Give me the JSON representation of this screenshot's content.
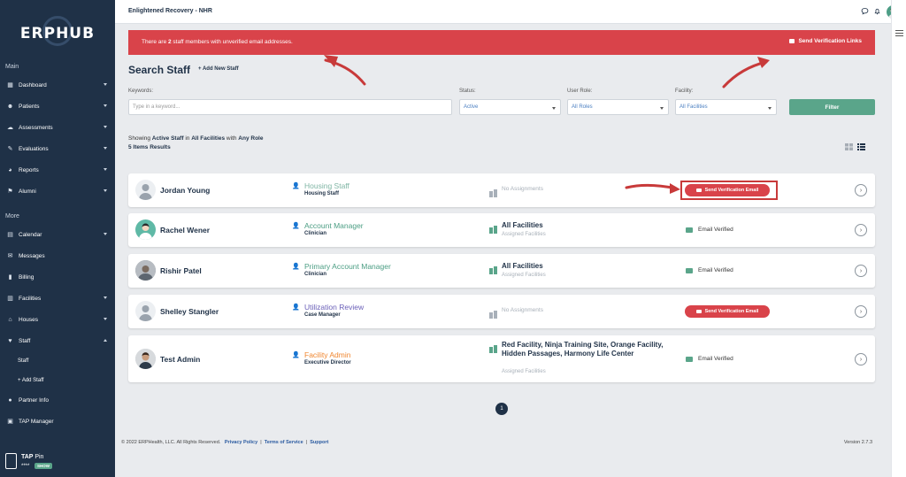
{
  "sidebar": {
    "logo": "ERPHUB",
    "main_label": "Main",
    "more_label": "More",
    "items": [
      {
        "label": "Dashboard",
        "icon": "dashboard-icon"
      },
      {
        "label": "Patients",
        "icon": "patients-icon"
      },
      {
        "label": "Assessments",
        "icon": "assessments-icon"
      },
      {
        "label": "Evaluations",
        "icon": "evaluations-icon"
      },
      {
        "label": "Reports",
        "icon": "reports-icon"
      },
      {
        "label": "Alumni",
        "icon": "alumni-icon"
      },
      {
        "label": "Calendar",
        "icon": "calendar-icon"
      },
      {
        "label": "Messages",
        "icon": "messages-icon"
      },
      {
        "label": "Billing",
        "icon": "billing-icon"
      },
      {
        "label": "Facilities",
        "icon": "facilities-icon"
      },
      {
        "label": "Houses",
        "icon": "houses-icon"
      },
      {
        "label": "Staff",
        "icon": "staff-icon"
      },
      {
        "label": "Partner Info",
        "icon": "partner-icon"
      },
      {
        "label": "TAP Manager",
        "icon": "tap-manager-icon"
      }
    ],
    "sub_items": [
      "Staff",
      "+ Add Staff"
    ],
    "tap": {
      "title_bold": "TAP",
      "title_rest": "Pin",
      "mask": "****",
      "show": "SHOW"
    }
  },
  "topbar": {
    "title": "Enlightened Recovery - NHR"
  },
  "alert": {
    "text_before": "There are ",
    "count": "2",
    "text_after": " staff members with unverified email addresses.",
    "button": "Send Verification Links"
  },
  "page": {
    "title": "Search Staff",
    "add_new": "+ Add New Staff"
  },
  "filters": {
    "keywords_label": "Keywords:",
    "keywords_placeholder": "Type in a keyword...",
    "status_label": "Status:",
    "status_value": "Active",
    "role_label": "User Role:",
    "role_value": "All Roles",
    "facility_label": "Facility:",
    "facility_value": "All Facilities",
    "filter_button": "Filter"
  },
  "summary": {
    "showing_pre": "Showing ",
    "status": "Active Staff",
    "in": " in ",
    "facility": "All Facilities",
    "with": " with ",
    "role": "Any Role",
    "results": "5 Items Results"
  },
  "staff": [
    {
      "name": "Jordan Young",
      "role": "Housing Staff",
      "role_color": "#7fb5a4",
      "title": "Housing Staff",
      "facilities": "No Assignments",
      "facility_sub": "",
      "verified": false,
      "action": "Send Verification Email"
    },
    {
      "name": "Rachel Wener",
      "role": "Account Manager",
      "role_color": "#4c9e84",
      "title": "Clinician",
      "facilities": "All Facilities",
      "facility_sub": "Assigned Facilities",
      "verified": true,
      "action": "Email Verified"
    },
    {
      "name": "Rishir Patel",
      "role": "Primary Account Manager",
      "role_color": "#4c9e84",
      "title": "Clinician",
      "facilities": "All Facilities",
      "facility_sub": "Assigned Facilities",
      "verified": true,
      "action": "Email Verified"
    },
    {
      "name": "Shelley Stangler",
      "role": "Utilization Review",
      "role_color": "#6a5fb8",
      "title": "Case Manager",
      "facilities": "No Assignments",
      "facility_sub": "",
      "verified": false,
      "action": "Send Verification Email"
    },
    {
      "name": "Test Admin",
      "role": "Facility Admin",
      "role_color": "#f0862f",
      "title": "Executive Director",
      "facilities": "Red Facility, Ninja Training Site, Orange Facility, Hidden Passages, Harmony Life Center",
      "facility_sub": "Assigned Facilities",
      "verified": true,
      "action": "Email Verified"
    }
  ],
  "pagination": {
    "current": "1"
  },
  "footer": {
    "copyright": "© 2022 ERPHealth, LLC. All Rights Reserved.",
    "privacy": "Privacy Policy",
    "terms": "Terms of Service",
    "support": "Support",
    "sep": "|",
    "version": "Version 2.7.3"
  },
  "colors": {
    "sidebar": "#1f3147",
    "alert": "#d9434a",
    "accent": "#5aa58a"
  }
}
